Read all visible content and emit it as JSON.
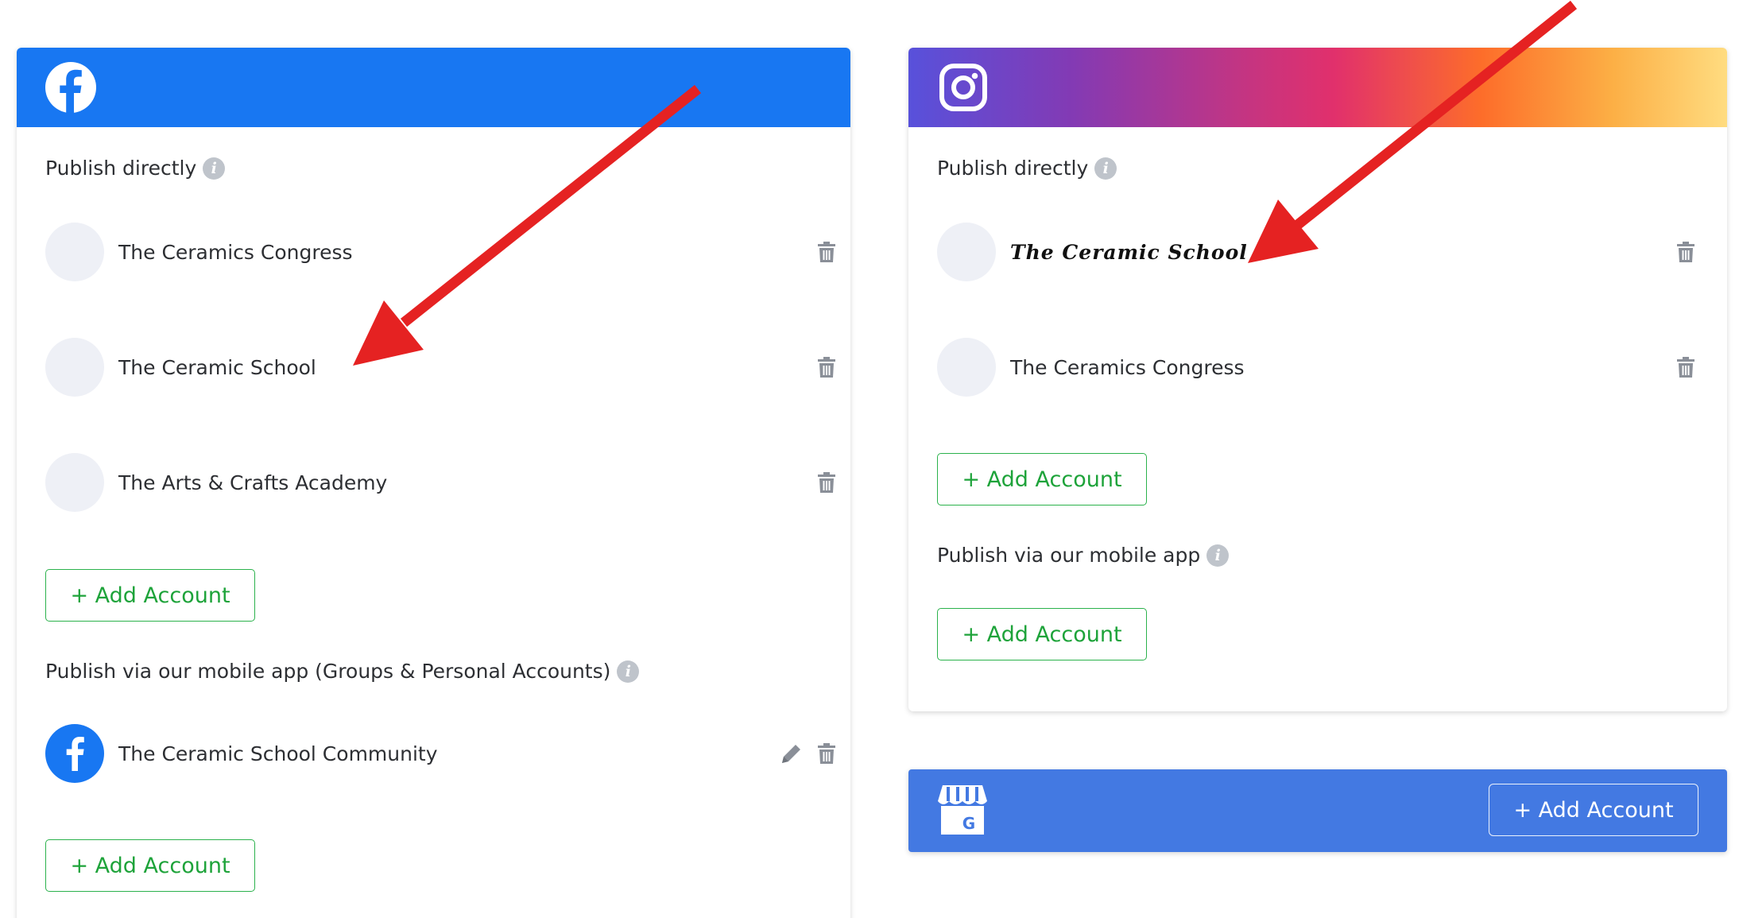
{
  "colors": {
    "facebook_blue": "#1877f2",
    "gmb_blue": "#4379e2",
    "add_green": "#1ea33a",
    "arrow_red": "#e52222"
  },
  "facebook": {
    "header_icon": "facebook-logo-icon",
    "publish_directly": {
      "title": "Publish directly",
      "accounts": [
        {
          "name": "The Ceramics Congress"
        },
        {
          "name": "The Ceramic School"
        },
        {
          "name": "The Arts & Crafts Academy"
        }
      ],
      "add_label": "+ Add Account"
    },
    "mobile_app": {
      "title": "Publish via our mobile app (Groups & Personal Accounts)",
      "accounts": [
        {
          "name": "The Ceramic School Community"
        }
      ],
      "add_label": "+ Add Account"
    }
  },
  "instagram": {
    "header_icon": "instagram-logo-icon",
    "publish_directly": {
      "title": "Publish directly",
      "accounts": [
        {
          "name": "The Ceramic School"
        },
        {
          "name": "The Ceramics Congress"
        }
      ],
      "add_label": "+ Add Account"
    },
    "mobile_app": {
      "title": "Publish via our mobile app",
      "add_label": "+ Add Account"
    }
  },
  "google_business": {
    "header_icon": "google-my-business-icon",
    "add_label": "+ Add Account"
  }
}
